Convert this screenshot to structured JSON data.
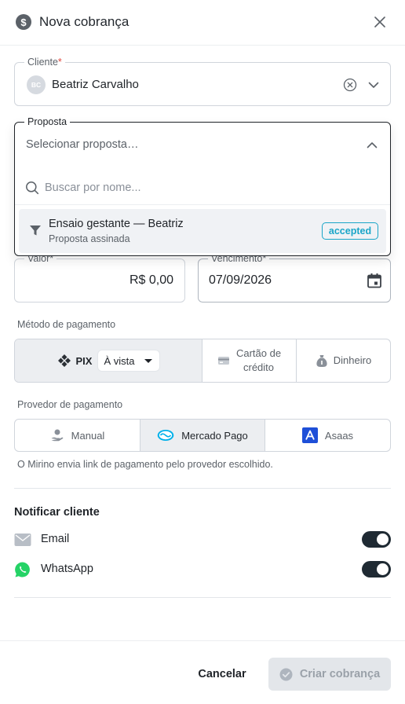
{
  "header": {
    "app_icon_glyph": "$",
    "app_icon": "dollar-circle-icon",
    "title": "Nova cobrança"
  },
  "client": {
    "label": "Cliente",
    "required_mark": "*",
    "initials": "BC",
    "name": "Beatriz Carvalho"
  },
  "proposal": {
    "label": "Proposta",
    "placeholder": "Selecionar proposta…",
    "search_placeholder": "Buscar por nome...",
    "options": [
      {
        "title": "Ensaio gestante — Beatriz",
        "subtitle": "Proposta assinada",
        "status": "accepted",
        "icon": "funnel-icon"
      }
    ]
  },
  "amount": {
    "label": "Valor",
    "required_mark": "*",
    "value": "R$ 0,00"
  },
  "due_date": {
    "label": "Vencimento",
    "required_mark": "*",
    "value": "07/09/2026"
  },
  "payment_method": {
    "label": "Método de pagamento",
    "pix_label": "PIX",
    "pix_terms": "À vista",
    "card_label_line1": "Cartão de",
    "card_label_line2": "crédito",
    "cash_label": "Dinheiro",
    "selected": "PIX"
  },
  "provider": {
    "label": "Provedor de pagamento",
    "options": [
      "Manual",
      "Mercado Pago",
      "Asaas"
    ],
    "selected": "Mercado Pago",
    "helper": "O Mirino envia link de pagamento pelo provedor escolhido."
  },
  "notify": {
    "title": "Notificar cliente",
    "email_label": "Email",
    "email_enabled": true,
    "whatsapp_label": "WhatsApp",
    "whatsapp_enabled": true
  },
  "footer": {
    "cancel_label": "Cancelar",
    "create_label": "Criar cobrança"
  },
  "colors": {
    "accent": "#1f2a33",
    "badge": "#1aa5c8",
    "required": "#e0463c",
    "whatsapp": "#25d366",
    "asaas": "#1e4fd8",
    "mercado_pago": "#00b1ea"
  }
}
